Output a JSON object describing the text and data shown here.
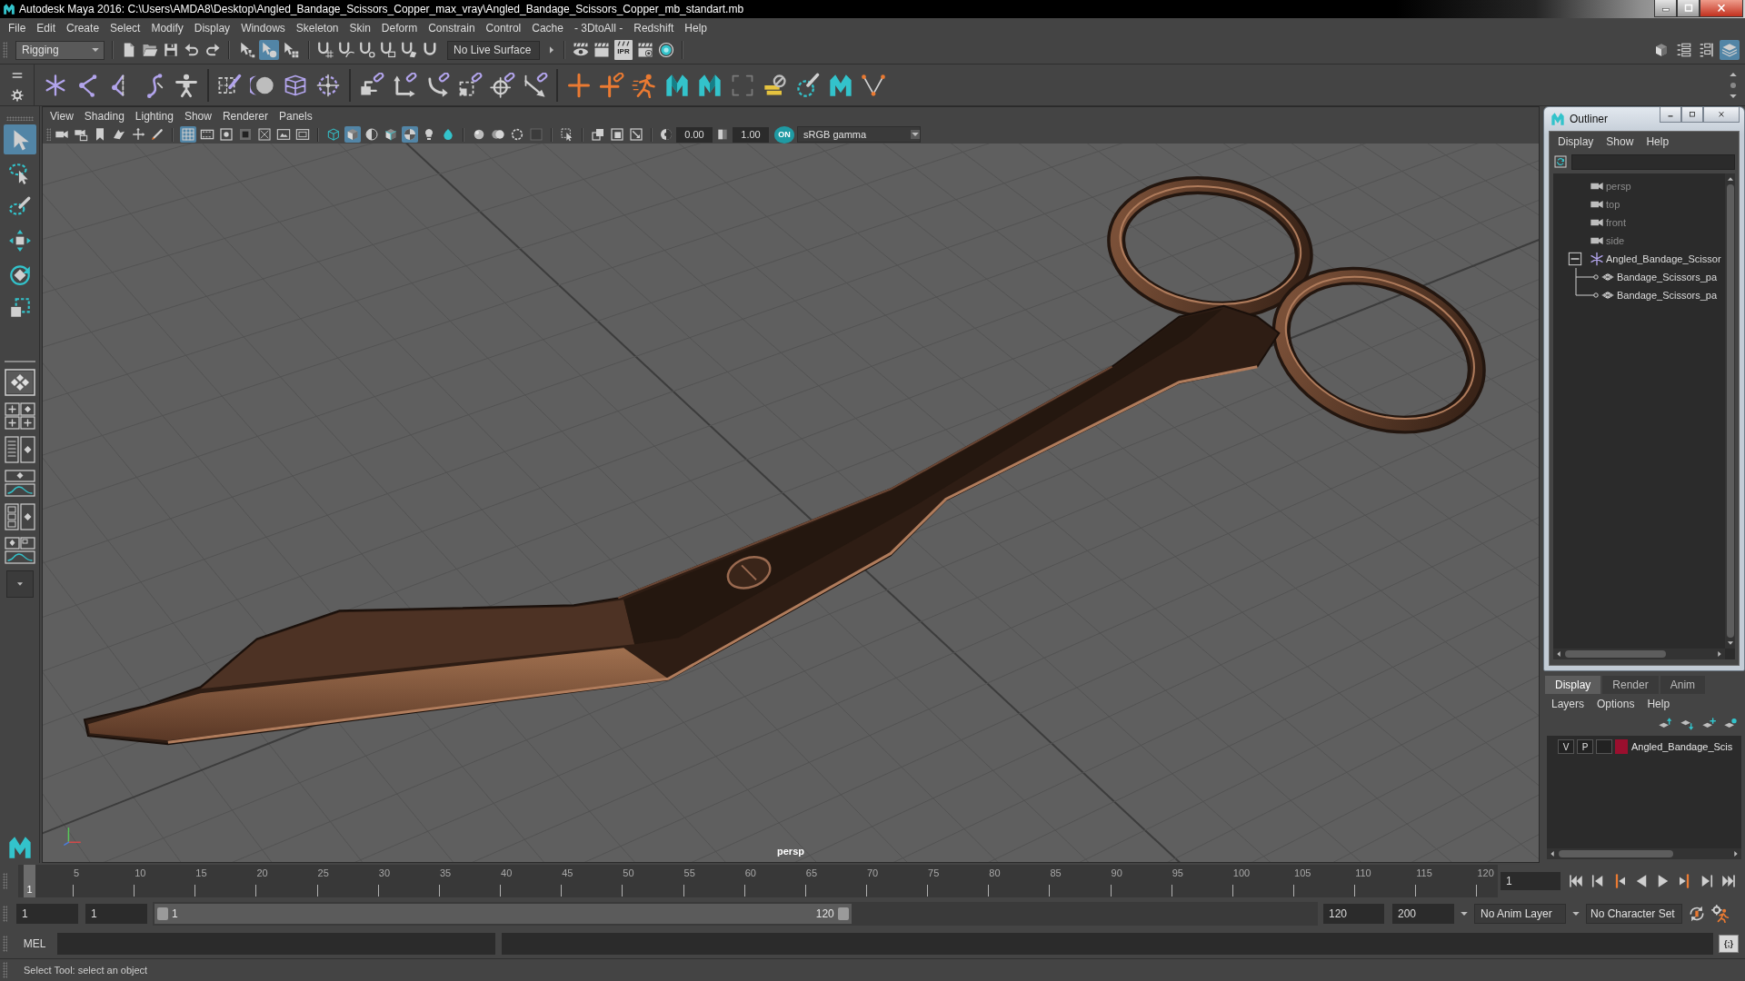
{
  "window": {
    "title": "Autodesk Maya 2016: C:\\Users\\AMDA8\\Desktop\\Angled_Bandage_Scissors_Copper_max_vray\\Angled_Bandage_Scissors_Copper_mb_standart.mb"
  },
  "menu_bar": [
    "File",
    "Edit",
    "Create",
    "Select",
    "Modify",
    "Display",
    "Windows",
    "Skeleton",
    "Skin",
    "Deform",
    "Constrain",
    "Control",
    "Cache",
    "- 3DtoAll -",
    "Redshift",
    "Help"
  ],
  "status_line": {
    "menu_set": "Rigging",
    "selection_modes": [
      {
        "kind": "hierarchy",
        "selected": false
      },
      {
        "kind": "object",
        "selected": true
      },
      {
        "kind": "component",
        "selected": false
      }
    ],
    "live_surface": "No Live Surface",
    "ipr_label": "IPR",
    "panel_toggles": [
      {
        "kind": "toolkit",
        "selected": false
      },
      {
        "kind": "attributes",
        "selected": false
      },
      {
        "kind": "tool_settings",
        "selected": false
      },
      {
        "kind": "channel_box",
        "selected": true
      }
    ]
  },
  "toolbox": {
    "tools": [
      {
        "kind": "select",
        "selected": true
      },
      {
        "kind": "lasso",
        "selected": false
      },
      {
        "kind": "paint",
        "selected": false
      },
      {
        "kind": "move",
        "selected": false
      },
      {
        "kind": "rotate",
        "selected": false
      },
      {
        "kind": "scale",
        "selected": false
      }
    ]
  },
  "viewport": {
    "menu": [
      "View",
      "Shading",
      "Lighting",
      "Show",
      "Renderer",
      "Panels"
    ],
    "toolbar": [
      [
        {
          "kind": "camera",
          "selected": false
        },
        {
          "kind": "camera_attributes",
          "selected": false
        },
        {
          "kind": "bookmark",
          "selected": false
        },
        {
          "kind": "image_plane",
          "selected": false
        },
        {
          "kind": "pan_zoom",
          "selected": false
        },
        {
          "kind": "grease_pencil",
          "selected": false
        }
      ],
      [
        {
          "kind": "grid",
          "selected": true
        },
        {
          "kind": "film_gate",
          "selected": false
        },
        {
          "kind": "resolution_gate",
          "selected": false
        },
        {
          "kind": "gate_mask",
          "selected": false
        },
        {
          "kind": "field_chart",
          "selected": false
        },
        {
          "kind": "safe_action",
          "selected": false
        },
        {
          "kind": "safe_title",
          "selected": false
        }
      ],
      [
        {
          "kind": "wireframe",
          "selected": false
        },
        {
          "kind": "smooth_shade",
          "selected": true
        },
        {
          "kind": "half_shade",
          "selected": false
        },
        {
          "kind": "wire_on_shaded",
          "selected": false
        },
        {
          "kind": "textured",
          "selected": true
        },
        {
          "kind": "lights",
          "selected": false
        },
        {
          "kind": "shadows",
          "selected": false
        }
      ],
      [
        {
          "kind": "sphere",
          "selected": false
        },
        {
          "kind": "two_spheres",
          "selected": false
        },
        {
          "kind": "dashed_ring",
          "selected": false
        },
        {
          "kind": "filled_square",
          "selected": false
        }
      ],
      [
        {
          "kind": "isolate",
          "selected": false
        }
      ],
      [
        {
          "kind": "overlap",
          "selected": false
        },
        {
          "kind": "nested",
          "selected": false
        },
        {
          "kind": "arrow_square",
          "selected": false
        }
      ]
    ],
    "exposure": "0.00",
    "gamma": "1.00",
    "color_management": {
      "on": true,
      "label": "ON"
    },
    "view_transform": "sRGB gamma",
    "camera": "persp"
  },
  "outliner": {
    "title": "Outliner",
    "menu": [
      "Display",
      "Show",
      "Help"
    ],
    "items": [
      {
        "label": "persp",
        "kind": "camera",
        "selected": false
      },
      {
        "label": "top",
        "kind": "camera",
        "selected": false
      },
      {
        "label": "front",
        "kind": "camera",
        "selected": false
      },
      {
        "label": "side",
        "kind": "camera",
        "selected": false
      },
      {
        "label": "Angled_Bandage_Scissor",
        "kind": "group",
        "selected": false,
        "expanded": true,
        "children": [
          {
            "label": "Bandage_Scissors_pa",
            "kind": "mesh",
            "selected": false
          },
          {
            "label": "Bandage_Scissors_pa",
            "kind": "mesh",
            "selected": false
          }
        ]
      }
    ]
  },
  "layer_editor": {
    "tabs": [
      {
        "label": "Display",
        "selected": true
      },
      {
        "label": "Render",
        "selected": false
      },
      {
        "label": "Anim",
        "selected": false
      }
    ],
    "menu": [
      "Layers",
      "Options",
      "Help"
    ],
    "layers": [
      {
        "visibility": "V",
        "playback": "P",
        "name": "Angled_Bandage_Scis",
        "color": "#9a0f2e",
        "selected": false
      }
    ]
  },
  "time_slider": {
    "current_frame": "1",
    "level": 0,
    "labels": [
      "5",
      "10",
      "15",
      "20",
      "25",
      "30",
      "35",
      "40",
      "45",
      "50",
      "55",
      "60",
      "65",
      "70",
      "75",
      "80",
      "85",
      "90",
      "95",
      "100",
      "105",
      "110",
      "115",
      "120"
    ],
    "frame_field": "1"
  },
  "range_slider": {
    "start": "1",
    "playback_start": "1",
    "range_start": "1",
    "range_end": "120",
    "level": 0.6,
    "playback_end": "120",
    "end": "200",
    "anim_layer": "No Anim Layer",
    "character_set": "No Character Set"
  },
  "command_line": {
    "language": "MEL",
    "script_editor": "{;}"
  },
  "help_line": "Select Tool: select an object"
}
